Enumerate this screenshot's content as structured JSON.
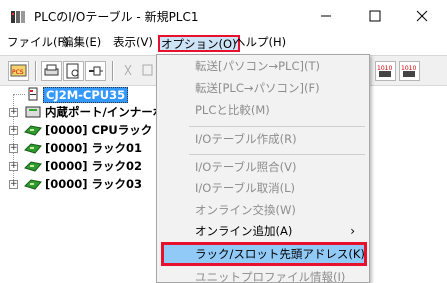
{
  "window": {
    "title": "PLCのI/Oテーブル - 新規PLC1"
  },
  "menubar": {
    "file": "ファイル(F)",
    "edit": "編集(E)",
    "view": "表示(V)",
    "options": "オプション(O)",
    "help": "ヘルプ(H)"
  },
  "tree": {
    "cpu": "CJ2M-CPU35",
    "builtin": "内蔵ポート/インナーボード",
    "racks": [
      "[0000] CPUラック",
      "[0000] ラック01",
      "[0000] ラック02",
      "[0000] ラック03"
    ]
  },
  "dropdown": {
    "items": [
      {
        "label": "転送[パソコン→PLC](T)",
        "enabled": false
      },
      {
        "label": "転送[PLC→パソコン](F)",
        "enabled": false
      },
      {
        "label": "PLCと比較(M)",
        "enabled": false
      },
      {
        "label": "I/Oテーブル作成(R)",
        "enabled": false
      },
      {
        "label": "I/Oテーブル照合(V)",
        "enabled": false
      },
      {
        "label": "I/Oテーブル取消(L)",
        "enabled": false
      },
      {
        "label": "オンライン交換(W)",
        "enabled": false
      },
      {
        "label": "オンライン追加(A)",
        "enabled": true
      },
      {
        "label": "ラック/スロット先頭アドレス(K)",
        "enabled": true
      },
      {
        "label": "ユニットプロファイル情報(I)",
        "enabled": false
      }
    ]
  },
  "colors": {
    "highlight_border": "#e8112d",
    "selection_blue": "#3399ff",
    "hover_blue": "#91c9f7"
  }
}
